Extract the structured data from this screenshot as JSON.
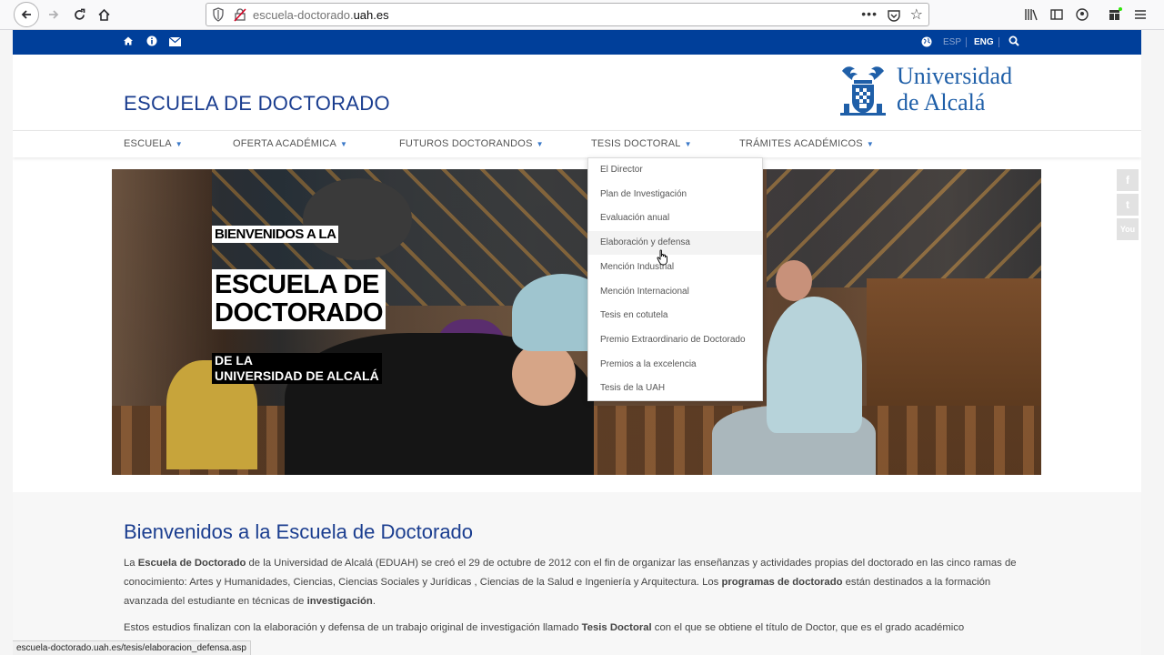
{
  "browser": {
    "url_prefix": "escuela-doctorado.",
    "url_domain": "uah.es",
    "more_label": "•••",
    "status_url": "escuela-doctorado.uah.es/tesis/elaboracion_defensa.asp"
  },
  "topbar": {
    "lang_esp": "ESP",
    "lang_eng": "ENG"
  },
  "header": {
    "site_title": "ESCUELA DE DOCTORADO",
    "uni_line1": "Universidad",
    "uni_line2": "de Alcalá"
  },
  "nav": {
    "items": [
      {
        "label": "ESCUELA"
      },
      {
        "label": "OFERTA ACADÉMICA"
      },
      {
        "label": "FUTUROS DOCTORANDOS"
      },
      {
        "label": "TESIS DOCTORAL"
      },
      {
        "label": "TRÁMITES ACADÉMICOS"
      }
    ]
  },
  "dropdown": {
    "items": [
      {
        "label": "El Director"
      },
      {
        "label": "Plan de Investigación"
      },
      {
        "label": "Evaluación anual"
      },
      {
        "label": "Elaboración y defensa"
      },
      {
        "label": "Mención Industrial"
      },
      {
        "label": "Mención Internacional"
      },
      {
        "label": "Tesis en cotutela"
      },
      {
        "label": "Premio Extraordinario de Doctorado"
      },
      {
        "label": "Premios a la excelencia"
      },
      {
        "label": "Tesis de la UAH"
      }
    ]
  },
  "hero": {
    "line1": "BIENVENIDOS A LA",
    "line2a": "ESCUELA DE",
    "line2b": "DOCTORADO",
    "line3a": "DE LA",
    "line3b": "UNIVERSIDAD DE ALCALÁ"
  },
  "social": {
    "facebook": "f",
    "twitter": "t",
    "youtube": "You"
  },
  "content": {
    "heading": "Bienvenidos a la Escuela de Doctorado",
    "p1_a": "La ",
    "p1_b": "Escuela de Doctorado",
    "p1_c": " de la Universidad de Alcalá (EDUAH) se creó el 29 de octubre de 2012 con el fin de organizar las enseñanzas y actividades propias del doctorado en las cinco ramas de conocimiento: Artes y Humanidades, Ciencias, Ciencias Sociales y Jurídicas , Ciencias de la Salud e Ingeniería y Arquitectura. Los ",
    "p1_d": "programas de doctorado",
    "p1_e": " están destinados a la formación avanzada del estudiante en técnicas de ",
    "p1_f": "investigación",
    "p1_g": ".",
    "p2_a": "Estos estudios finalizan con la elaboración y defensa de un trabajo original de investigación llamado ",
    "p2_b": "Tesis Doctoral",
    "p2_c": " con el que se obtiene el título de Doctor, que es el grado académico"
  },
  "colors": {
    "topbar": "#003f9a",
    "title": "#1a3d8f",
    "caret": "#3b79c8"
  }
}
